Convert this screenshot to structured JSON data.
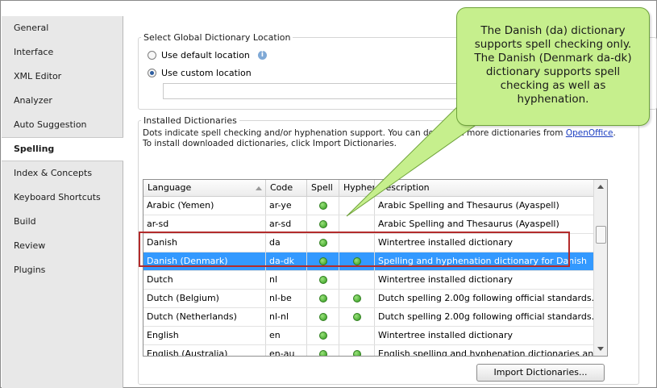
{
  "sidebar": {
    "items": [
      {
        "label": "General"
      },
      {
        "label": "Interface"
      },
      {
        "label": "XML Editor"
      },
      {
        "label": "Analyzer"
      },
      {
        "label": "Auto Suggestion"
      },
      {
        "label": "Spelling"
      },
      {
        "label": "Index & Concepts"
      },
      {
        "label": "Keyboard Shortcuts"
      },
      {
        "label": "Build"
      },
      {
        "label": "Review"
      },
      {
        "label": "Plugins"
      }
    ],
    "active": "Spelling"
  },
  "location": {
    "title": "Select Global Dictionary Location",
    "default_label": "Use default location",
    "custom_label": "Use custom location",
    "selected": "custom",
    "path_value": ""
  },
  "installed": {
    "title": "Installed Dictionaries",
    "desc_before": "Dots indicate spell checking and/or hyphenation support. You can download more dictionaries from ",
    "desc_link": "OpenOffice",
    "desc_after": ". To install downloaded dictionaries, click Import Dictionaries.",
    "columns": {
      "language": "Language",
      "code": "Code",
      "spell": "Spell",
      "hyphen": "Hyphen",
      "description": "Description"
    },
    "rows": [
      {
        "language": "Arabic (Yemen)",
        "code": "ar-ye",
        "spell": true,
        "hyphen": false,
        "description": "Arabic Spelling and Thesaurus (Ayaspell)"
      },
      {
        "language": "ar-sd",
        "code": "ar-sd",
        "spell": true,
        "hyphen": false,
        "description": "Arabic Spelling and Thesaurus (Ayaspell)"
      },
      {
        "language": "Danish",
        "code": "da",
        "spell": true,
        "hyphen": false,
        "description": "Wintertree installed dictionary"
      },
      {
        "language": "Danish (Denmark)",
        "code": "da-dk",
        "spell": true,
        "hyphen": true,
        "description": "Spelling and hyphenation dictionary for Danish",
        "selected": true
      },
      {
        "language": "Dutch",
        "code": "nl",
        "spell": true,
        "hyphen": false,
        "description": "Wintertree installed dictionary"
      },
      {
        "language": "Dutch (Belgium)",
        "code": "nl-be",
        "spell": true,
        "hyphen": true,
        "description": "Dutch spelling 2.00g following official standards."
      },
      {
        "language": "Dutch (Netherlands)",
        "code": "nl-nl",
        "spell": true,
        "hyphen": true,
        "description": "Dutch spelling 2.00g following official standards."
      },
      {
        "language": "English",
        "code": "en",
        "spell": true,
        "hyphen": false,
        "description": "Wintertree installed dictionary"
      },
      {
        "language": "English (Australia)",
        "code": "en-au",
        "spell": true,
        "hyphen": true,
        "description": "English spelling and hyphenation dictionaries and th…"
      }
    ],
    "import_label": "Import Dictionaries..."
  },
  "callout": {
    "text": "The Danish (da) dictionary supports spell checking only. The Danish (Denmark da-dk) dictionary supports spell checking as well as hyphenation."
  },
  "colors": {
    "selection": "#3399ff",
    "callout_fill": "#c6ef8d",
    "highlight_border": "#b32b2b",
    "link": "#1a3dc1"
  },
  "icons": {
    "info": "info-icon",
    "sort": "sort-ascending-icon",
    "supported": "green-dot-icon"
  }
}
